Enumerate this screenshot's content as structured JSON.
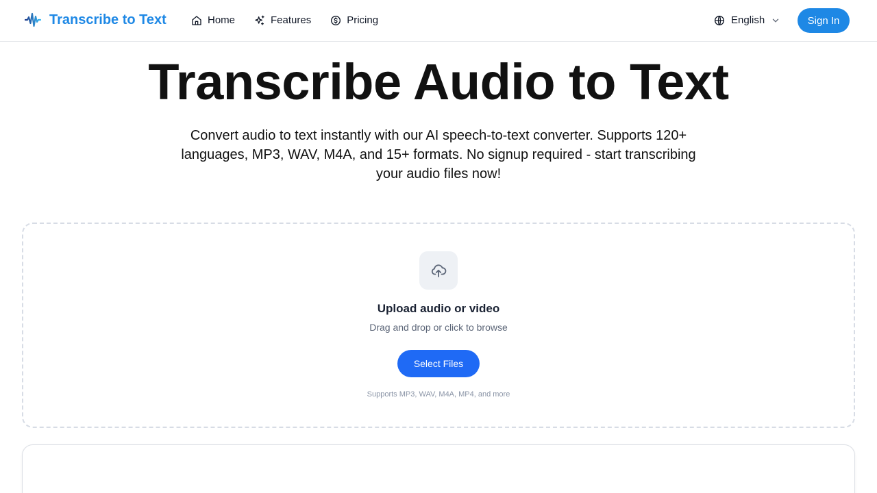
{
  "header": {
    "brand_name": "Transcribe to Text",
    "brand_color": "#1e88e5",
    "brand_icon": "sound-wave-icon",
    "nav": [
      {
        "label": "Home",
        "icon": "home-icon"
      },
      {
        "label": "Features",
        "icon": "sparkles-icon"
      },
      {
        "label": "Pricing",
        "icon": "dollar-circle-icon"
      }
    ],
    "language": {
      "label": "English",
      "icon": "globe-icon",
      "caret": "chevron-down-icon"
    },
    "signin_label": "Sign In"
  },
  "hero": {
    "title": "Transcribe Audio to Text",
    "subtitle": "Convert audio to text instantly with our AI speech-to-text converter. Supports 120+ languages, MP3, WAV, M4A, and 15+ formats. No signup required - start transcribing your audio files now!"
  },
  "upload": {
    "icon": "cloud-upload-icon",
    "title": "Upload audio or video",
    "hint": "Drag and drop or click to browse",
    "button_label": "Select Files",
    "button_color": "#1f6af5",
    "formats_note": "Supports MP3, WAV, M4A, MP4, and more"
  }
}
